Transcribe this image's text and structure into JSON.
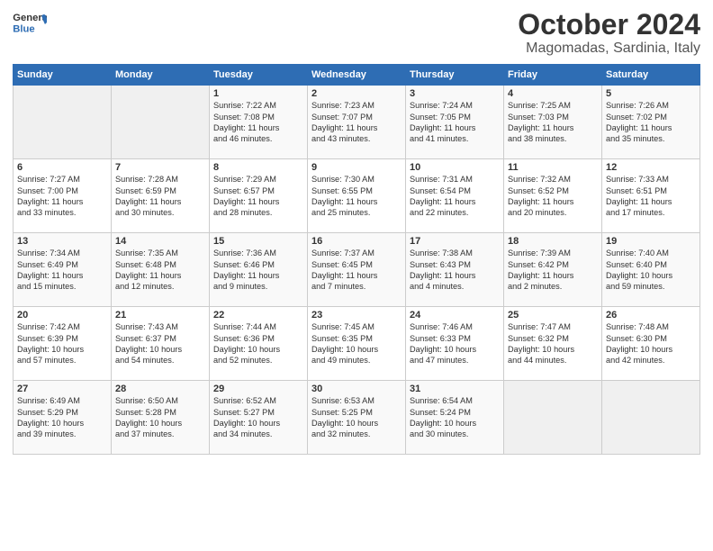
{
  "logo": {
    "general": "General",
    "blue": "Blue"
  },
  "title": "October 2024",
  "location": "Magomadas, Sardinia, Italy",
  "headers": [
    "Sunday",
    "Monday",
    "Tuesday",
    "Wednesday",
    "Thursday",
    "Friday",
    "Saturday"
  ],
  "weeks": [
    [
      {
        "day": "",
        "info": ""
      },
      {
        "day": "",
        "info": ""
      },
      {
        "day": "1",
        "info": "Sunrise: 7:22 AM\nSunset: 7:08 PM\nDaylight: 11 hours\nand 46 minutes."
      },
      {
        "day": "2",
        "info": "Sunrise: 7:23 AM\nSunset: 7:07 PM\nDaylight: 11 hours\nand 43 minutes."
      },
      {
        "day": "3",
        "info": "Sunrise: 7:24 AM\nSunset: 7:05 PM\nDaylight: 11 hours\nand 41 minutes."
      },
      {
        "day": "4",
        "info": "Sunrise: 7:25 AM\nSunset: 7:03 PM\nDaylight: 11 hours\nand 38 minutes."
      },
      {
        "day": "5",
        "info": "Sunrise: 7:26 AM\nSunset: 7:02 PM\nDaylight: 11 hours\nand 35 minutes."
      }
    ],
    [
      {
        "day": "6",
        "info": "Sunrise: 7:27 AM\nSunset: 7:00 PM\nDaylight: 11 hours\nand 33 minutes."
      },
      {
        "day": "7",
        "info": "Sunrise: 7:28 AM\nSunset: 6:59 PM\nDaylight: 11 hours\nand 30 minutes."
      },
      {
        "day": "8",
        "info": "Sunrise: 7:29 AM\nSunset: 6:57 PM\nDaylight: 11 hours\nand 28 minutes."
      },
      {
        "day": "9",
        "info": "Sunrise: 7:30 AM\nSunset: 6:55 PM\nDaylight: 11 hours\nand 25 minutes."
      },
      {
        "day": "10",
        "info": "Sunrise: 7:31 AM\nSunset: 6:54 PM\nDaylight: 11 hours\nand 22 minutes."
      },
      {
        "day": "11",
        "info": "Sunrise: 7:32 AM\nSunset: 6:52 PM\nDaylight: 11 hours\nand 20 minutes."
      },
      {
        "day": "12",
        "info": "Sunrise: 7:33 AM\nSunset: 6:51 PM\nDaylight: 11 hours\nand 17 minutes."
      }
    ],
    [
      {
        "day": "13",
        "info": "Sunrise: 7:34 AM\nSunset: 6:49 PM\nDaylight: 11 hours\nand 15 minutes."
      },
      {
        "day": "14",
        "info": "Sunrise: 7:35 AM\nSunset: 6:48 PM\nDaylight: 11 hours\nand 12 minutes."
      },
      {
        "day": "15",
        "info": "Sunrise: 7:36 AM\nSunset: 6:46 PM\nDaylight: 11 hours\nand 9 minutes."
      },
      {
        "day": "16",
        "info": "Sunrise: 7:37 AM\nSunset: 6:45 PM\nDaylight: 11 hours\nand 7 minutes."
      },
      {
        "day": "17",
        "info": "Sunrise: 7:38 AM\nSunset: 6:43 PM\nDaylight: 11 hours\nand 4 minutes."
      },
      {
        "day": "18",
        "info": "Sunrise: 7:39 AM\nSunset: 6:42 PM\nDaylight: 11 hours\nand 2 minutes."
      },
      {
        "day": "19",
        "info": "Sunrise: 7:40 AM\nSunset: 6:40 PM\nDaylight: 10 hours\nand 59 minutes."
      }
    ],
    [
      {
        "day": "20",
        "info": "Sunrise: 7:42 AM\nSunset: 6:39 PM\nDaylight: 10 hours\nand 57 minutes."
      },
      {
        "day": "21",
        "info": "Sunrise: 7:43 AM\nSunset: 6:37 PM\nDaylight: 10 hours\nand 54 minutes."
      },
      {
        "day": "22",
        "info": "Sunrise: 7:44 AM\nSunset: 6:36 PM\nDaylight: 10 hours\nand 52 minutes."
      },
      {
        "day": "23",
        "info": "Sunrise: 7:45 AM\nSunset: 6:35 PM\nDaylight: 10 hours\nand 49 minutes."
      },
      {
        "day": "24",
        "info": "Sunrise: 7:46 AM\nSunset: 6:33 PM\nDaylight: 10 hours\nand 47 minutes."
      },
      {
        "day": "25",
        "info": "Sunrise: 7:47 AM\nSunset: 6:32 PM\nDaylight: 10 hours\nand 44 minutes."
      },
      {
        "day": "26",
        "info": "Sunrise: 7:48 AM\nSunset: 6:30 PM\nDaylight: 10 hours\nand 42 minutes."
      }
    ],
    [
      {
        "day": "27",
        "info": "Sunrise: 6:49 AM\nSunset: 5:29 PM\nDaylight: 10 hours\nand 39 minutes."
      },
      {
        "day": "28",
        "info": "Sunrise: 6:50 AM\nSunset: 5:28 PM\nDaylight: 10 hours\nand 37 minutes."
      },
      {
        "day": "29",
        "info": "Sunrise: 6:52 AM\nSunset: 5:27 PM\nDaylight: 10 hours\nand 34 minutes."
      },
      {
        "day": "30",
        "info": "Sunrise: 6:53 AM\nSunset: 5:25 PM\nDaylight: 10 hours\nand 32 minutes."
      },
      {
        "day": "31",
        "info": "Sunrise: 6:54 AM\nSunset: 5:24 PM\nDaylight: 10 hours\nand 30 minutes."
      },
      {
        "day": "",
        "info": ""
      },
      {
        "day": "",
        "info": ""
      }
    ]
  ]
}
